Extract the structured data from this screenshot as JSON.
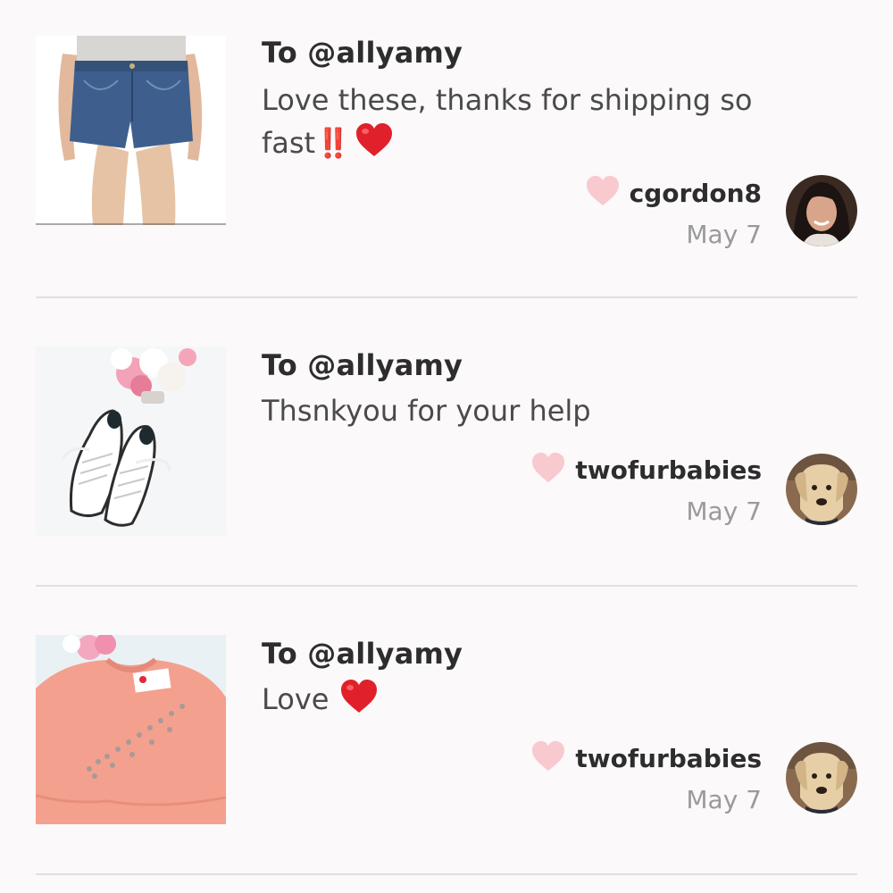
{
  "feed": {
    "items": [
      {
        "to": "To @allyamy",
        "message": "Love these, thanks for shipping so fast",
        "message_suffix": "‼️",
        "username": "cgordon8",
        "date": "May 7",
        "thumbnail_icon": "denim-shorts",
        "avatar_icon": "woman-avatar"
      },
      {
        "to": "To @allyamy",
        "message": "Thsnkyou for your help",
        "username": "twofurbabies",
        "date": "May 7",
        "thumbnail_icon": "white-sneakers",
        "avatar_icon": "dog-avatar"
      },
      {
        "to": "To @allyamy",
        "message": "Love",
        "username": "twofurbabies",
        "date": "May 7",
        "thumbnail_icon": "peach-sweater",
        "avatar_icon": "dog-avatar"
      }
    ]
  },
  "colors": {
    "background": "#fbf9fa",
    "like_heart": "#f9c9d0",
    "emoji_red": "#e0202a",
    "divider": "#e4dedf"
  }
}
